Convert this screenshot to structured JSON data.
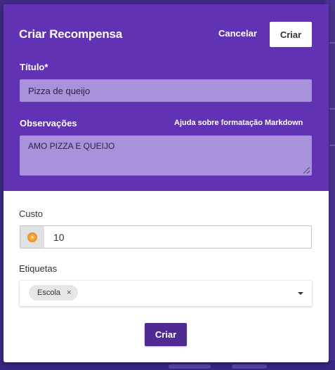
{
  "modal": {
    "title": "Criar Recompensa",
    "cancel_label": "Cancelar",
    "create_top_label": "Criar",
    "title_field_label": "Título*",
    "title_value": "Pizza de queijo",
    "notes_label": "Observações",
    "markdown_help": "Ajuda sobre formatação Markdown",
    "notes_value": "AMO PIZZA E QUEIJO",
    "cost_label": "Custo",
    "cost_value": "10",
    "cost_icon": "gold-coin-icon",
    "tags_label": "Etiquetas",
    "tags": [
      {
        "label": "Escola",
        "remove": "×"
      }
    ],
    "create_bottom_label": "Criar"
  },
  "colors": {
    "header_bg": "#6133b4",
    "input_bg": "#a892dc",
    "primary_button": "#4f2a93",
    "backdrop": "#3f2a86",
    "coin": "#f5a83a"
  }
}
